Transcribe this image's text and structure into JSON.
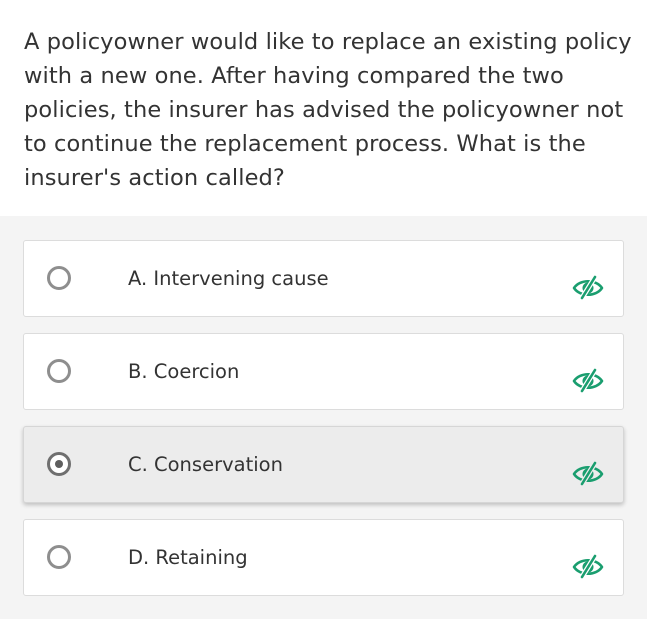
{
  "question": {
    "text": "A policyowner would like to replace an existing policy with a new one. After having compared the two policies, the insurer has advised the policyowner not to continue the replacement process. What is the insurer's action called?"
  },
  "options": [
    {
      "label": "A. Intervening cause",
      "selected": false,
      "icon": "eye-slash-icon"
    },
    {
      "label": "B. Coercion",
      "selected": false,
      "icon": "eye-slash-icon"
    },
    {
      "label": "C. Conservation",
      "selected": true,
      "icon": "eye-slash-icon"
    },
    {
      "label": "D. Retaining",
      "selected": false,
      "icon": "eye-slash-icon"
    }
  ],
  "colors": {
    "accent": "#1a9e6f",
    "text": "#333333",
    "selected_background": "#ececec"
  }
}
